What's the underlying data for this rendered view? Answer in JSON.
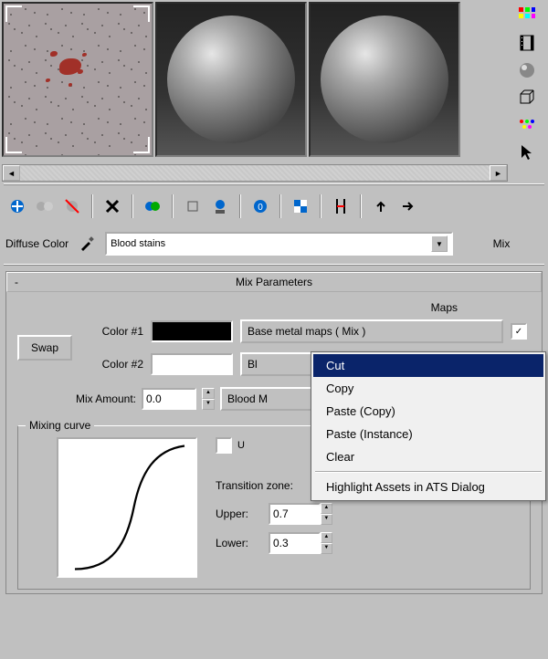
{
  "side_toolbar": {
    "icons": [
      "palette-icon",
      "filmstrip-icon",
      "sphere-icon",
      "cube-outline-icon",
      "teapot-icon",
      "arrow-cursor-icon"
    ]
  },
  "name_row": {
    "channel_label": "Diffuse Color",
    "map_name": "Blood stains",
    "map_type": "Mix"
  },
  "rollout": {
    "toggle": "-",
    "title": "Mix Parameters",
    "maps_header": "Maps",
    "swap_label": "Swap",
    "color1_label": "Color #1",
    "color2_label": "Color #2",
    "color1_value": "#000000",
    "color2_value": "#ffffff",
    "map1_button": "Base metal maps  ( Mix )",
    "map1_checked": "✓",
    "map2_button": "Bl",
    "mixamount_label": "Mix Amount:",
    "mixamount_value": "0.0",
    "mixmap_button": "Blood M"
  },
  "mixing_curve": {
    "legend": "Mixing curve",
    "use_label": "U",
    "transition_label": "Transition zone:",
    "upper_label": "Upper:",
    "upper_value": "0.7",
    "lower_label": "Lower:",
    "lower_value": "0.3"
  },
  "context_menu": {
    "items": [
      "Cut",
      "Copy",
      "Paste (Copy)",
      "Paste (Instance)",
      "Clear"
    ],
    "final_item": "Highlight Assets in ATS Dialog",
    "highlighted_index": 0
  }
}
